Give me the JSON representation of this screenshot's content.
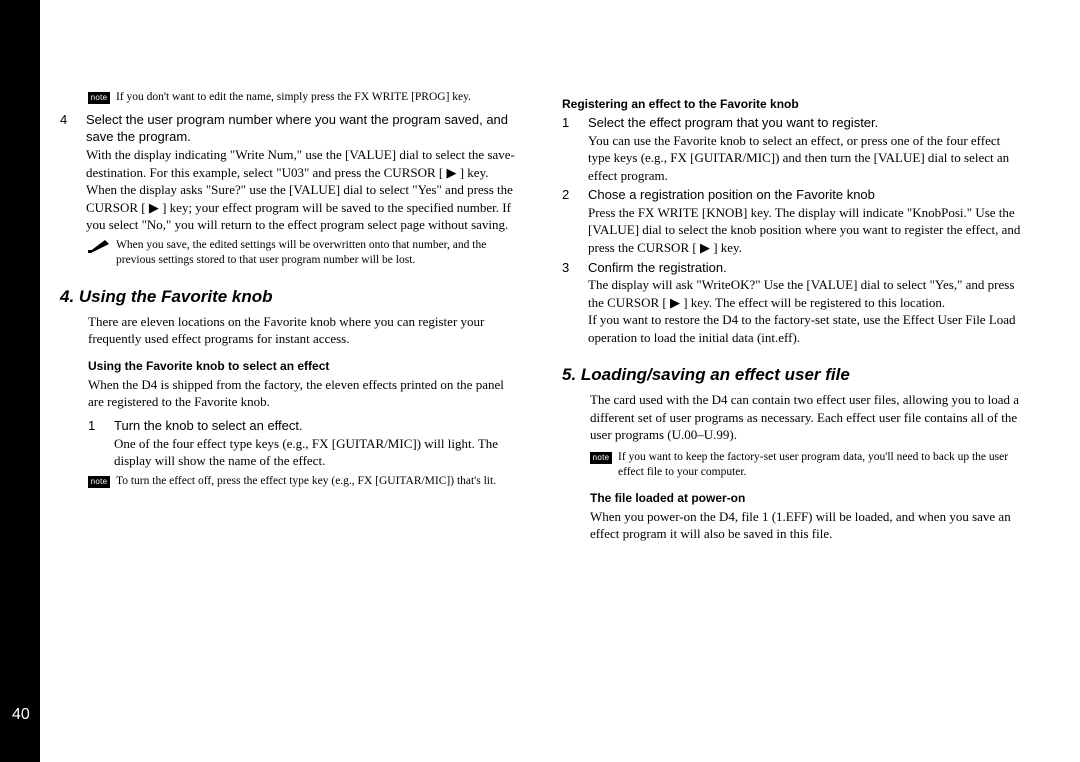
{
  "pageNumber": "40",
  "noteBadge": "note",
  "left": {
    "note1": "If you don't want to edit the name, simply press the FX WRITE [PROG] key.",
    "step4num": "4",
    "step4title": "Select the user program number where you want the program saved, and save the program.",
    "step4detail": "With the display indicating \"Write Num,\" use the [VALUE] dial to select the save-destination. For this example, select \"U03\" and press the CURSOR [ ▶ ] key.\nWhen the display asks \"Sure?\" use the [VALUE] dial to select \"Yes\" and press the CURSOR [ ▶ ] key; your effect program will be saved to the specified number. If you select \"No,\" you will return to the effect program select page without saving.",
    "warn1": "When you save, the edited settings will be overwritten onto that number, and the previous settings stored to that user program number will be lost.",
    "h2a": "4. Using the Favorite knob",
    "paraA": "There are eleven locations on the Favorite knob where you can register your frequently used effect programs for instant access.",
    "h3a": "Using the Favorite knob to select an effect",
    "paraB": "When the D4 is shipped from the factory, the eleven effects printed on the panel are registered to the Favorite knob.",
    "step1num": "1",
    "step1title": "Turn the knob to select an effect.",
    "step1detail": "One of the four effect type keys (e.g., FX [GUITAR/MIC]) will light. The display will show the name of the effect.",
    "note2": "To turn the effect off, press the effect type key (e.g., FX [GUITAR/MIC]) that's lit."
  },
  "right": {
    "h3a": "Registering an effect to the Favorite knob",
    "step1num": "1",
    "step1title": "Select the effect program that you want to register.",
    "step1detail": "You can use the Favorite knob to select an effect, or press one of the four effect type keys (e.g., FX [GUITAR/MIC]) and then turn the [VALUE] dial to select an effect program.",
    "step2num": "2",
    "step2title": "Chose a registration position on the Favorite knob",
    "step2detail": "Press the FX WRITE [KNOB] key. The display will indicate \"KnobPosi.\" Use the [VALUE] dial to select the knob position where you want to register the effect, and press the CURSOR [ ▶ ] key.",
    "step3num": "3",
    "step3title": "Confirm the registration.",
    "step3detail": "The display will ask \"WriteOK?\" Use the [VALUE] dial to select \"Yes,\" and press the CURSOR [ ▶ ] key. The effect will be registered to this location.\nIf you want to restore the D4 to the factory-set state, use the Effect User File Load operation to load the initial data (int.eff).",
    "h2a": "5. Loading/saving an effect user file",
    "paraA": "The card used with the D4 can contain two effect user files, allowing you to load a different set of user programs as necessary. Each effect user file contains all of the user programs (U.00–U.99).",
    "note1": "If you want to keep the factory-set user program data, you'll need to back up the user effect file to your computer.",
    "h3b": "The file loaded at power-on",
    "paraB": "When you power-on the D4, file 1 (1.EFF) will be loaded, and when you save an effect program it will also be saved in this file."
  }
}
